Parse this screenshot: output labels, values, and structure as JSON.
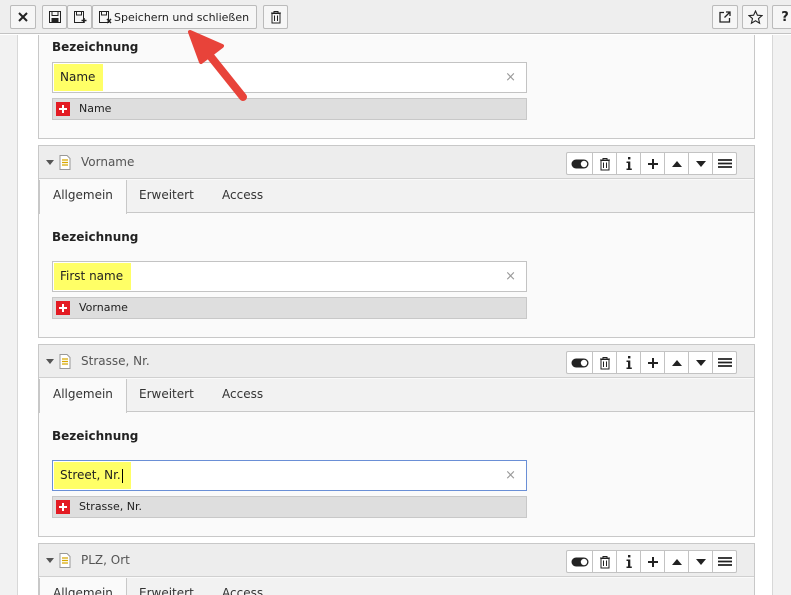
{
  "toolbar": {
    "close_icon": "close-icon",
    "save_icon": "save-icon",
    "save_new_icon": "save-new-icon",
    "save_close_icon": "save-close-icon",
    "save_close_label": "Speichern und schließen",
    "delete_icon": "trash-icon",
    "open_new_window_icon": "external-link-icon",
    "bookmark_icon": "star-icon",
    "help_label": "?"
  },
  "panels": [
    {
      "title": "",
      "field_label": "Bezeichnung",
      "value": "Name",
      "default_lang_value": "Name"
    },
    {
      "title": "Vorname",
      "tabs": [
        "Allgemein",
        "Erweitert",
        "Access"
      ],
      "field_label": "Bezeichnung",
      "value": "First name",
      "default_lang_value": "Vorname"
    },
    {
      "title": "Strasse, Nr.",
      "tabs": [
        "Allgemein",
        "Erweitert",
        "Access"
      ],
      "field_label": "Bezeichnung",
      "value": "Street, Nr.",
      "default_lang_value": "Strasse, Nr."
    },
    {
      "title": "PLZ, Ort",
      "tabs": [
        "Allgemein",
        "Erweitert",
        "Access"
      ]
    }
  ],
  "clear_glyph": "×",
  "colors": {
    "highlight": "#ffff66",
    "arrow": "#e8433a",
    "flag": "#e31b23"
  }
}
